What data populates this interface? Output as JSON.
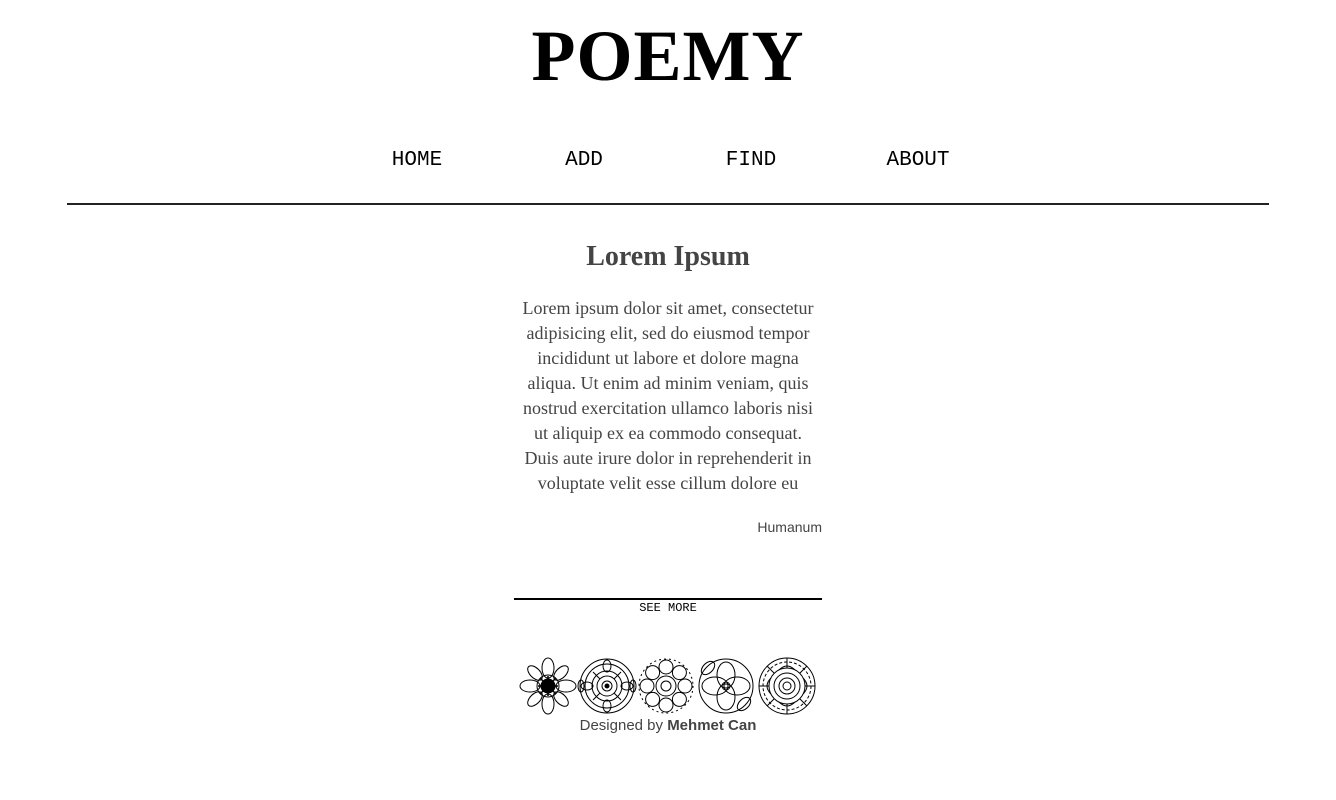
{
  "header": {
    "title": "POEMY"
  },
  "nav": {
    "items": [
      {
        "label": "HOME"
      },
      {
        "label": "ADD"
      },
      {
        "label": "FIND"
      },
      {
        "label": "ABOUT"
      }
    ]
  },
  "post": {
    "title": "Lorem Ipsum",
    "body": "Lorem ipsum dolor sit amet, consectetur adipisicing elit, sed do eiusmod tempor incididunt ut labore et dolore magna aliqua. Ut enim ad minim veniam, quis nostrud exercitation ullamco laboris nisi ut aliquip ex ea commodo consequat. Duis aute irure dolor in reprehenderit in voluptate velit esse cillum dolore eu",
    "author": "Humanum",
    "see_more_label": "SEE MORE"
  },
  "footer": {
    "prefix": "Designed by",
    "designer": "Mehmet Can"
  },
  "ornaments": [
    {
      "icon": "floral-mandala-icon"
    },
    {
      "icon": "circular-mandala-icon"
    },
    {
      "icon": "flower-ring-icon"
    },
    {
      "icon": "interlaced-knot-icon"
    },
    {
      "icon": "rosette-mandala-icon"
    }
  ]
}
